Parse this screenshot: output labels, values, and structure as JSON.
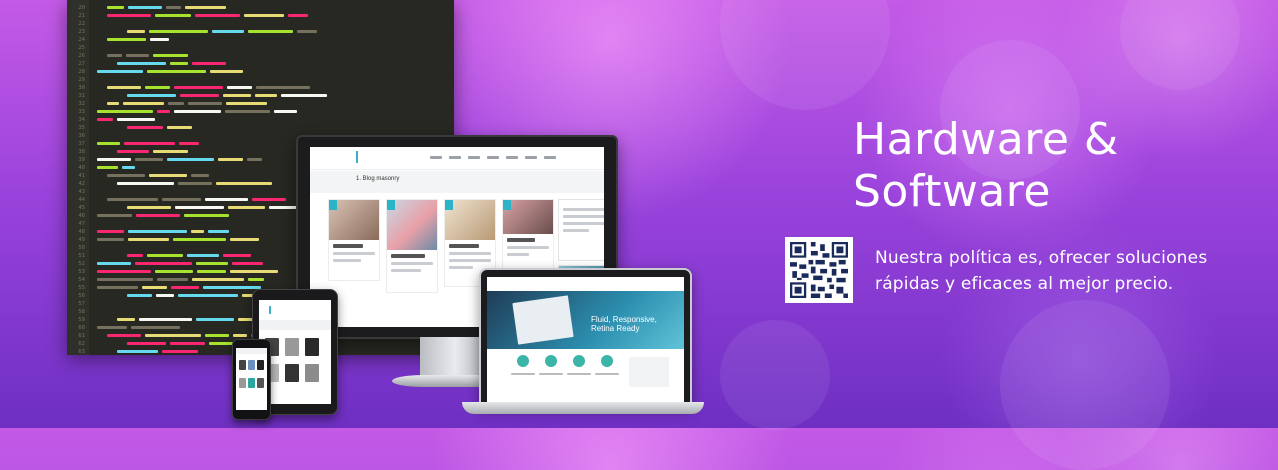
{
  "hero": {
    "headline_line1": "Hardware &",
    "headline_line2": "Software",
    "tagline_line1": "Nuestra política es, ofrecer soluciones",
    "tagline_line2": "rápidas y eficaces al mejor precio."
  },
  "code_editor": {
    "line_numbers": [
      "20",
      "21",
      "22",
      "23",
      "24",
      "25",
      "26",
      "27",
      "28",
      "29",
      "30",
      "31",
      "32",
      "33",
      "34",
      "35",
      "36",
      "37",
      "38",
      "39",
      "40",
      "41",
      "42",
      "43",
      "44",
      "45",
      "46",
      "47",
      "48",
      "49",
      "50",
      "51",
      "52",
      "53",
      "54",
      "55",
      "56",
      "57",
      "58",
      "59",
      "60",
      "61",
      "62",
      "63"
    ]
  },
  "monitor_site": {
    "page_title": "1. Blog masonry"
  },
  "laptop_site": {
    "hero_text_line1": "Fluid, Responsive,",
    "hero_text_line2": "Retina Ready"
  },
  "colors": {
    "background_top": "#c45ae6",
    "background_bottom": "#6e2fc2",
    "text": "#ffffff",
    "accent": "#2bb3c8"
  },
  "icons": {
    "qr": "qr-code-icon"
  }
}
